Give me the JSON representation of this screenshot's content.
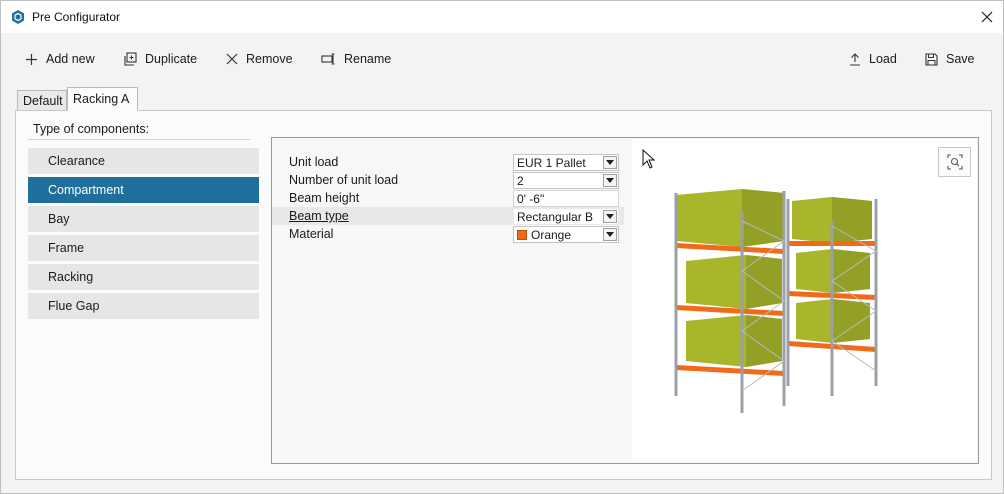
{
  "window": {
    "title": "Pre Configurator",
    "close_icon": "close-icon"
  },
  "toolbar": {
    "add_new": "Add new",
    "duplicate": "Duplicate",
    "remove": "Remove",
    "rename": "Rename",
    "load": "Load",
    "save": "Save"
  },
  "tabs": [
    {
      "label": "Default",
      "active": false
    },
    {
      "label": "Racking A",
      "active": true
    }
  ],
  "components": {
    "title": "Type of components:",
    "items": [
      {
        "label": "Clearance",
        "selected": false
      },
      {
        "label": "Compartment",
        "selected": true
      },
      {
        "label": "Bay",
        "selected": false
      },
      {
        "label": "Frame",
        "selected": false
      },
      {
        "label": "Racking",
        "selected": false
      },
      {
        "label": "Flue Gap",
        "selected": false
      }
    ]
  },
  "properties": [
    {
      "label": "Unit load",
      "value": "EUR 1 Pallet",
      "dropdown": true
    },
    {
      "label": "Number of unit load",
      "value": "2",
      "dropdown": true
    },
    {
      "label": "Beam height",
      "value": "0' -6\"",
      "dropdown": false
    },
    {
      "label": "Beam type",
      "value": "Rectangular B",
      "dropdown": true
    },
    {
      "label": "Material",
      "value": "Orange",
      "dropdown": true,
      "swatch": "#f06a1a"
    }
  ],
  "colors": {
    "selection": "#1f6f9c",
    "beam": "#f06a1a",
    "load": "#a9b52a",
    "upright": "#9aa0a6"
  }
}
